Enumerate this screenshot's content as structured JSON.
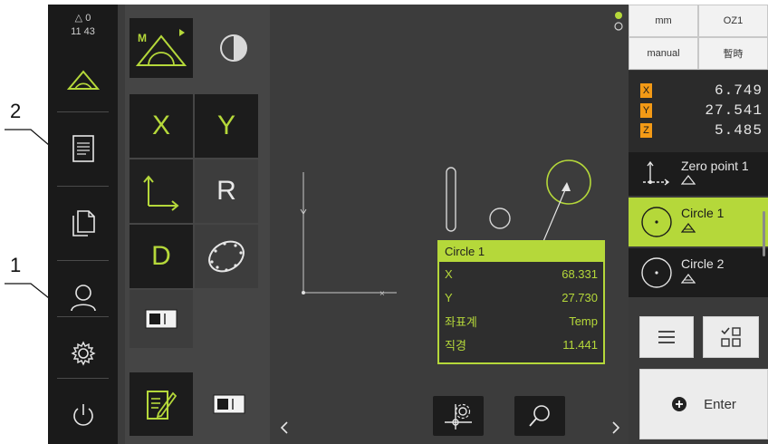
{
  "callouts": {
    "one": "1",
    "two": "2"
  },
  "status": {
    "counter": "0",
    "time": "11 43"
  },
  "mainmenu": {
    "items": [
      "measure-icon",
      "measurement-report-icon",
      "file-management-icon",
      "user-login-icon",
      "settings-icon",
      "switch-off-icon"
    ]
  },
  "palette": {
    "x_label": "X",
    "y_label": "Y",
    "r_label": "R",
    "d_label": "D",
    "manual_mode_label": "M"
  },
  "infobox": {
    "title": "Circle 1",
    "rows": [
      {
        "label": "X",
        "value": "68.331"
      },
      {
        "label": "Y",
        "value": "27.730"
      },
      {
        "label": "좌표계",
        "value": "Temp"
      },
      {
        "label": "직경",
        "value": "11.441"
      }
    ]
  },
  "right": {
    "unit": "mm",
    "preset": "OZ1",
    "mode": "manual",
    "temp": "暫時",
    "axes": [
      {
        "name": "X",
        "value": "6.749"
      },
      {
        "name": "Y",
        "value": "27.541"
      },
      {
        "name": "Z",
        "value": "5.485"
      }
    ],
    "features": [
      {
        "label_l1": "Zero point 1",
        "selected": false
      },
      {
        "label_l1": "Circle 1",
        "selected": true
      },
      {
        "label_l1": "Circle 2",
        "selected": false
      }
    ],
    "enter_label": "Enter"
  },
  "colors": {
    "accent": "#b5d83a",
    "axis_badge": "#f39a16",
    "screen_bg": "#3c3c3c",
    "menu_bg": "#1a1a1a"
  }
}
